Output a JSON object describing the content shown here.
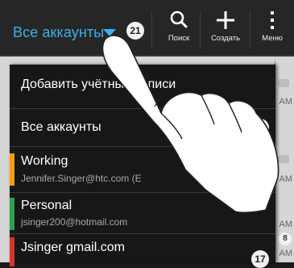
{
  "topbar": {
    "account_label": "Все аккаунты",
    "account_count": "21",
    "actions": [
      {
        "label": "Поиск",
        "icon": "search-icon"
      },
      {
        "label": "Создать",
        "icon": "plus-icon"
      },
      {
        "label": "Меню",
        "icon": "more-vert-icon"
      }
    ]
  },
  "dropdown": {
    "add_account_label": "Добавить учётные записи",
    "all_accounts": {
      "label": "Все аккаунты",
      "count": "21"
    },
    "accounts": [
      {
        "name": "Working",
        "email": "Jennifer.Singer@htc.com (E",
        "color": "#f39c12"
      },
      {
        "name": "Personal",
        "email": "jsinger200@hotmail.com",
        "color": "#2e9e4f"
      },
      {
        "name": "Jsinger gmail.com",
        "email": "",
        "color": "#d9342b",
        "count": "17"
      }
    ]
  },
  "background_list": {
    "timestamps": [
      "AM",
      "AM",
      "AM",
      "AM"
    ],
    "count_badge": "8"
  },
  "colors": {
    "accent": "#3bb0ea",
    "bar_bg": "#262626",
    "panel_bg": "#171717"
  }
}
